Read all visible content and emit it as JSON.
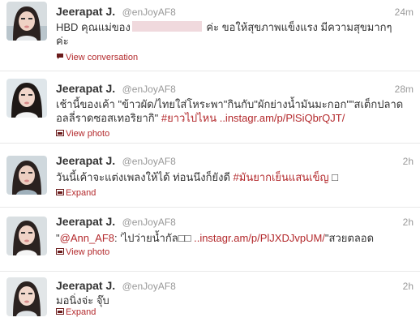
{
  "tweets": [
    {
      "fullname": "Jeerapat J.",
      "username": "@enJoyAF8",
      "time": "24m",
      "text_before": "HBD คุณแม่ของ",
      "text_after": " ค่ะ ขอให้สุขภาพแข็งแรง มีความสุขมากๆค่ะ",
      "action": "View conversation",
      "action_icon": "speech-bubble-icon"
    },
    {
      "fullname": "Jeerapat J.",
      "username": "@enJoyAF8",
      "time": "28m",
      "text": "เช้านี้ของเค้า \"ข้าวผัด/ไทยใส่โหระพา\"กินกับ\"ผักย่างน้ำมันมะกอก\"\"สเต็กปลาดอลลี่ราดซอสเทอริยากิ\" ",
      "hashtag": "#ยาวไปไหน",
      "link": " ..instagr.am/p/PlSiQbrQJT/",
      "action": "View photo",
      "action_icon": "photo-icon"
    },
    {
      "fullname": "Jeerapat J.",
      "username": "@enJoyAF8",
      "time": "2h",
      "text": "วันนี้เค้าจะแต่งเพลงให้ได้ ท่อนนึงก็ยังดี ",
      "hashtag": "#มันยากเย็นแสนเข็ญ",
      "text_end": " □",
      "action": "Expand",
      "action_icon": "expand-icon"
    },
    {
      "fullname": "Jeerapat J.",
      "username": "@enJoyAF8",
      "time": "2h",
      "text_start": "\"",
      "mention": "@Ann_AF8",
      "text": ": 'ไปว่ายน้ำกัล□□ ",
      "link": "..instagr.am/p/PlJXDJvpUM/",
      "text_end": "\"สวยตลอด",
      "action": "View photo",
      "action_icon": "photo-icon"
    },
    {
      "fullname": "Jeerapat J.",
      "username": "@enJoyAF8",
      "time": "2h",
      "text": "มอนิ่งจ่ะ จุ๊บ",
      "action": "Expand",
      "action_icon": "expand-icon"
    }
  ]
}
